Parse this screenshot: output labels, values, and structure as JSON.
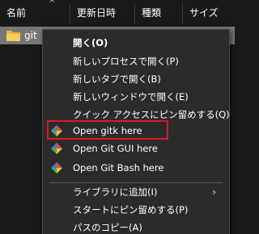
{
  "columns": {
    "name": "名前",
    "date": "更新日時",
    "type": "種類",
    "size": "サイズ"
  },
  "file_row": {
    "name": "git",
    "icon": "folder-icon"
  },
  "menu": {
    "open": "開く(O)",
    "open_new_process": "新しいプロセスで開く(P)",
    "open_new_tab": "新しいタブで開く(B)",
    "open_new_window": "新しいウィンドウで開く(E)",
    "pin_quick_access": "クイック アクセスにピン留めする(Q)",
    "open_gitk": "Open gitk here",
    "open_git_gui": "Open Git GUI here",
    "open_git_bash": "Open Git Bash here",
    "add_to_library": "ライブラリに追加(I)",
    "pin_start": "スタートにピン留めする(P)",
    "copy_path": "パスのコピー(A)"
  },
  "colors": {
    "background": "#191919",
    "menu_bg": "#2b2b2b",
    "selection": "#777777",
    "highlight_border": "#e0161e"
  }
}
